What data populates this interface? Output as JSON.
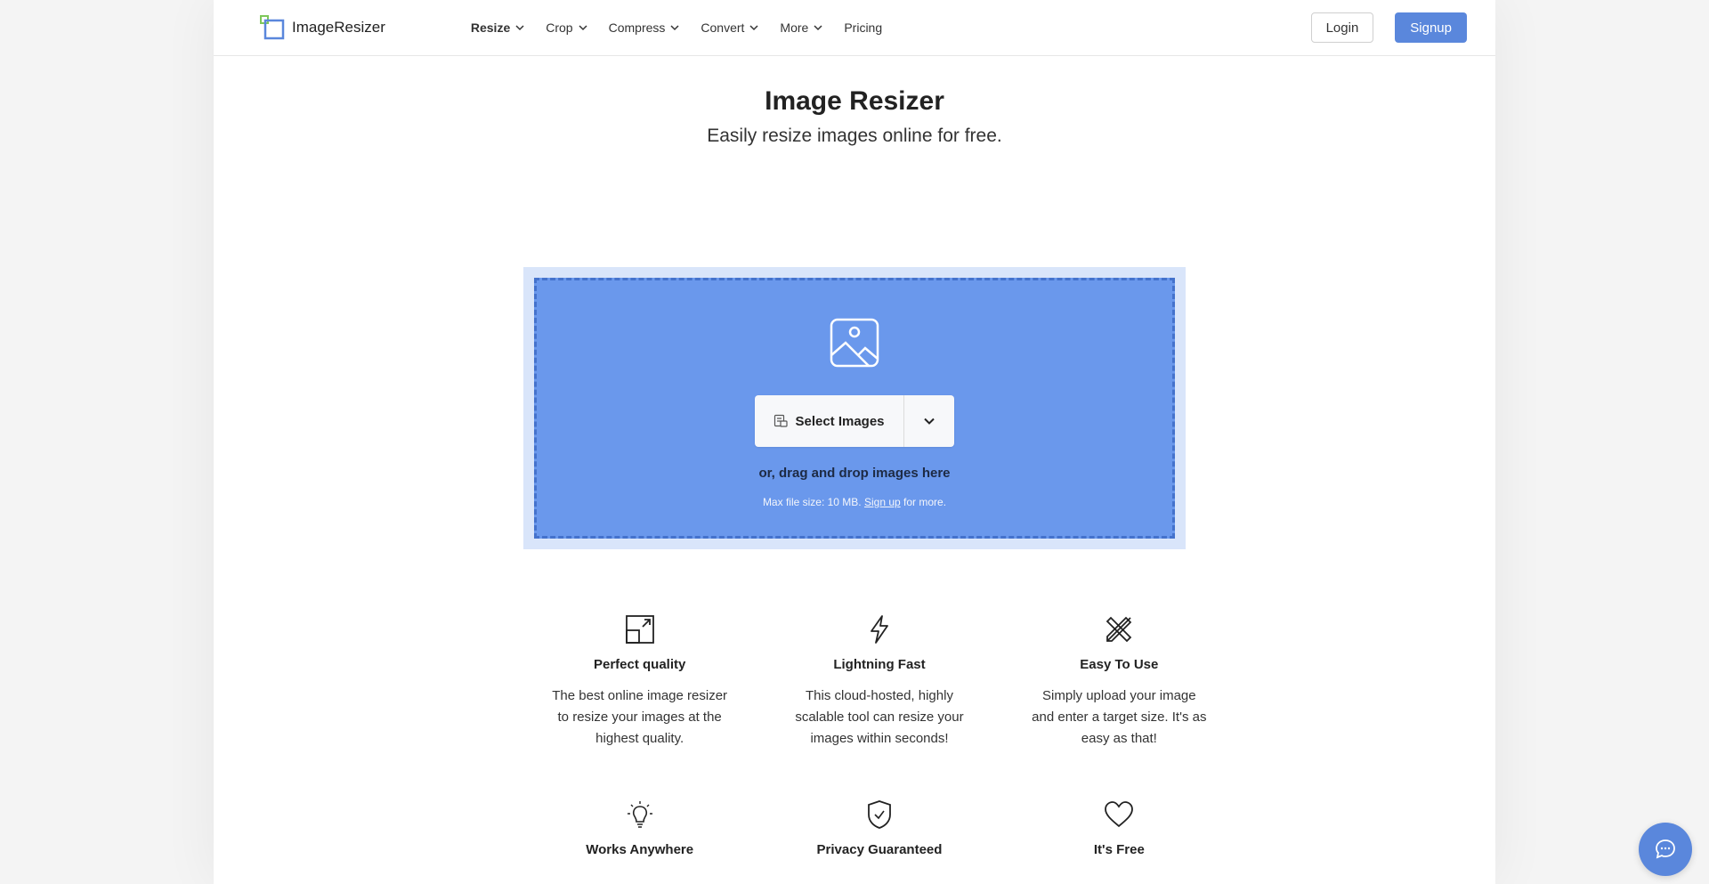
{
  "brand": {
    "name": "ImageResizer",
    "accent": "#5a87dc",
    "logo_green": "#7ec85a"
  },
  "nav": {
    "items": [
      {
        "label": "Resize",
        "has_menu": true,
        "active": true
      },
      {
        "label": "Crop",
        "has_menu": true
      },
      {
        "label": "Compress",
        "has_menu": true
      },
      {
        "label": "Convert",
        "has_menu": true
      },
      {
        "label": "More",
        "has_menu": true
      },
      {
        "label": "Pricing",
        "has_menu": false
      }
    ],
    "login_label": "Login",
    "signup_label": "Signup"
  },
  "hero": {
    "title": "Image Resizer",
    "subtitle": "Easily resize images online for free."
  },
  "upload": {
    "select_label": "Select Images",
    "drag_text": "or, drag and drop images here",
    "max_prefix": "Max file size: 10 MB.",
    "signup_link": "Sign up",
    "max_suffix": "for more.",
    "zone_color": "#6a98ec"
  },
  "features": [
    {
      "icon": "resize-icon",
      "title": "Perfect quality",
      "text": "The best online image resizer to resize your images at the highest quality."
    },
    {
      "icon": "lightning-icon",
      "title": "Lightning Fast",
      "text": "This cloud-hosted, highly scalable tool can resize your images within seconds!"
    },
    {
      "icon": "tools-icon",
      "title": "Easy To Use",
      "text": "Simply upload your image and enter a target size. It's as easy as that!"
    },
    {
      "icon": "lightbulb-icon",
      "title": "Works Anywhere",
      "text": ""
    },
    {
      "icon": "shield-icon",
      "title": "Privacy Guaranteed",
      "text": ""
    },
    {
      "icon": "heart-icon",
      "title": "It's Free",
      "text": ""
    }
  ],
  "chat": {
    "icon": "chat-icon"
  }
}
